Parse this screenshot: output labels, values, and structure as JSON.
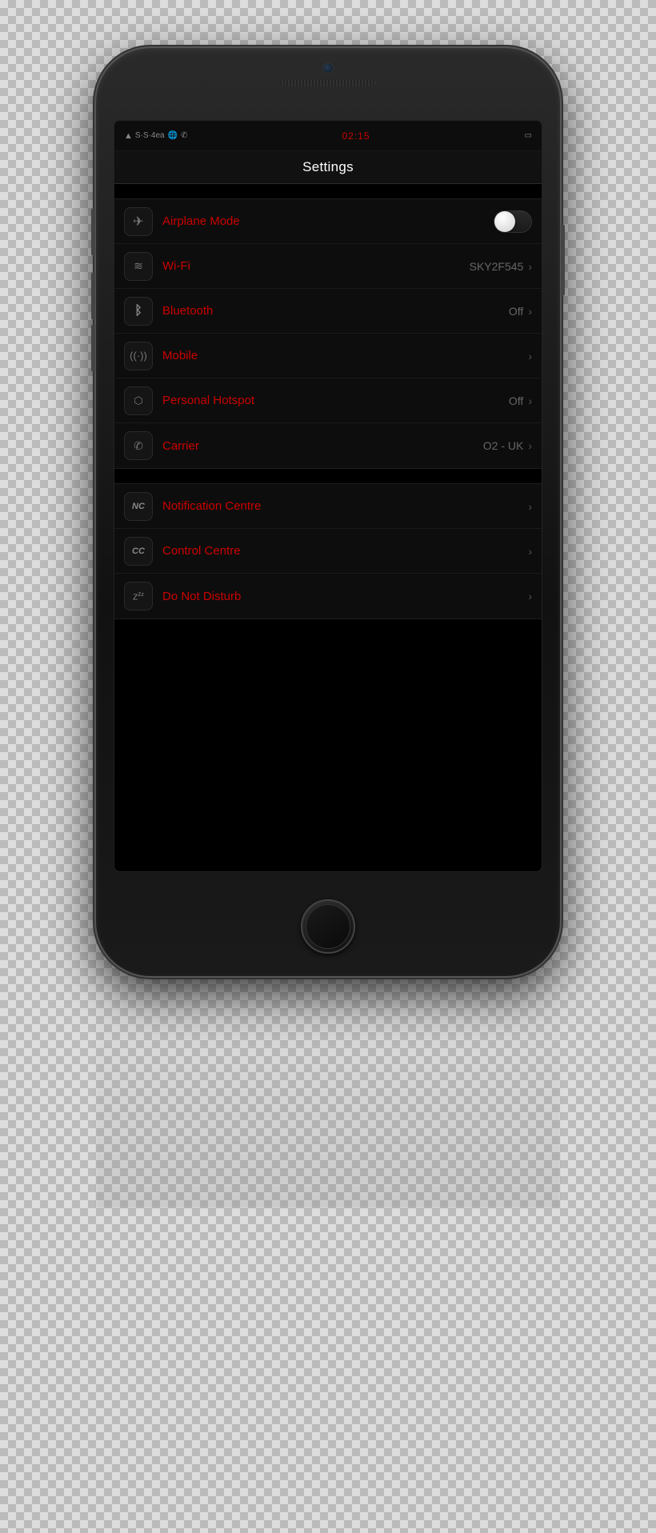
{
  "status_bar": {
    "time": "02:15",
    "carrier": "S·S·4ea",
    "battery_icon": "▓"
  },
  "nav": {
    "title": "Settings"
  },
  "groups": [
    {
      "id": "connectivity",
      "rows": [
        {
          "id": "airplane-mode",
          "label": "Airplane Mode",
          "icon_type": "airplane",
          "value": "",
          "has_toggle": true,
          "toggle_on": false,
          "has_chevron": false
        },
        {
          "id": "wifi",
          "label": "Wi-Fi",
          "icon_type": "wifi",
          "value": "SKY2F545",
          "has_toggle": false,
          "has_chevron": true
        },
        {
          "id": "bluetooth",
          "label": "Bluetooth",
          "icon_type": "bluetooth",
          "value": "Off",
          "has_toggle": false,
          "has_chevron": true
        },
        {
          "id": "mobile",
          "label": "Mobile",
          "icon_type": "mobile",
          "value": "",
          "has_toggle": false,
          "has_chevron": true
        },
        {
          "id": "personal-hotspot",
          "label": "Personal Hotspot",
          "icon_type": "hotspot",
          "value": "Off",
          "has_toggle": false,
          "has_chevron": true
        },
        {
          "id": "carrier",
          "label": "Carrier",
          "icon_type": "phone",
          "value": "O2 - UK",
          "has_toggle": false,
          "has_chevron": true
        }
      ]
    },
    {
      "id": "notifications",
      "rows": [
        {
          "id": "notification-centre",
          "label": "Notification Centre",
          "icon_type": "nc",
          "value": "",
          "has_toggle": false,
          "has_chevron": true
        },
        {
          "id": "control-centre",
          "label": "Control Centre",
          "icon_type": "cc",
          "value": "",
          "has_toggle": false,
          "has_chevron": true
        },
        {
          "id": "do-not-disturb",
          "label": "Do Not Disturb",
          "icon_type": "zzz",
          "value": "",
          "has_toggle": false,
          "has_chevron": true
        }
      ]
    }
  ]
}
